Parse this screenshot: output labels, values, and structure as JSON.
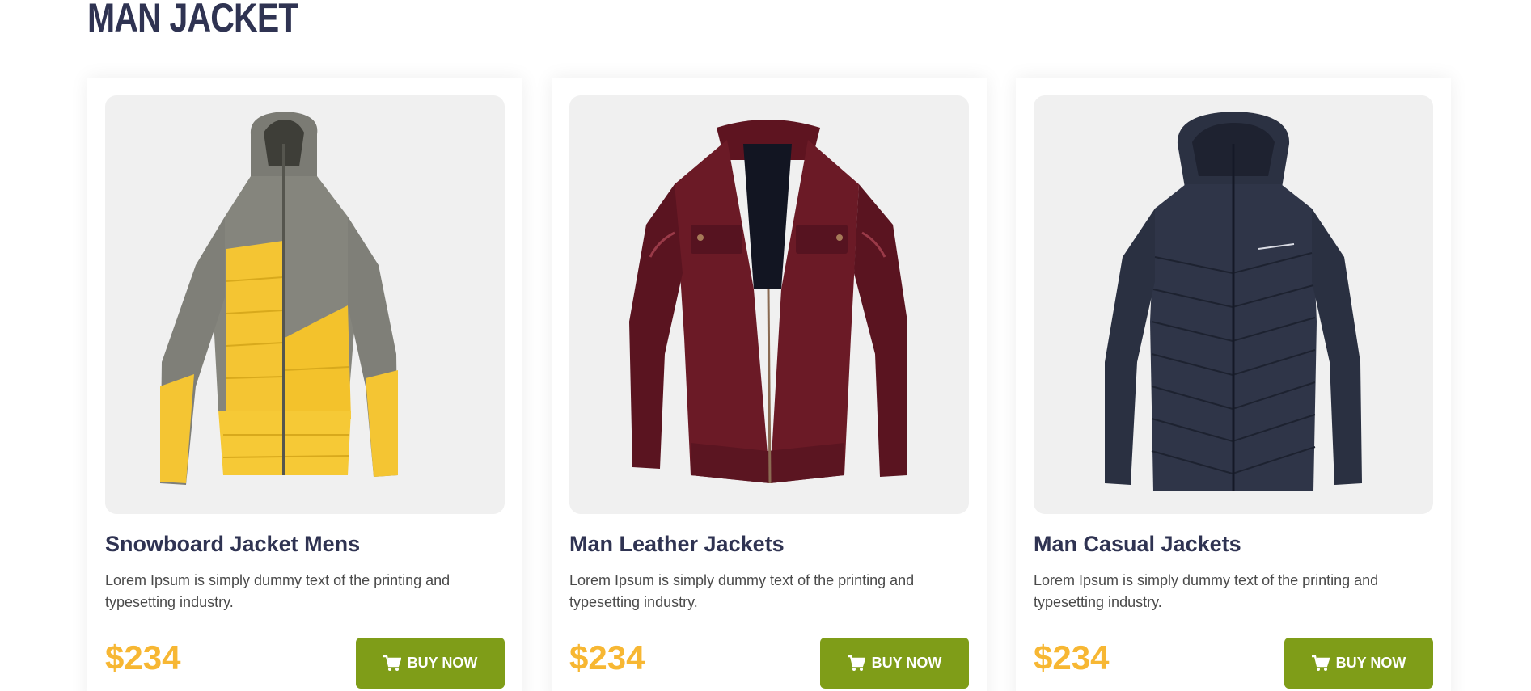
{
  "section": {
    "title": "MAN JACKET"
  },
  "products": [
    {
      "title": "Snowboard Jacket Mens",
      "description": "Lorem Ipsum is simply dummy text of the printing and typesetting industry.",
      "price": "$234",
      "button_label": "BUY NOW",
      "image_icon": "yellow-grey-puffer-jacket"
    },
    {
      "title": "Man Leather Jackets",
      "description": "Lorem Ipsum is simply dummy text of the printing and typesetting industry.",
      "price": "$234",
      "button_label": "BUY NOW",
      "image_icon": "maroon-leather-jacket"
    },
    {
      "title": "Man Casual Jackets",
      "description": "Lorem Ipsum is simply dummy text of the printing and typesetting industry.",
      "price": "$234",
      "button_label": "BUY NOW",
      "image_icon": "navy-hooded-puffer-jacket"
    }
  ],
  "colors": {
    "title": "#2f3352",
    "price": "#f7b733",
    "button": "#7f9d18",
    "image_bg": "#f0f0f0"
  }
}
